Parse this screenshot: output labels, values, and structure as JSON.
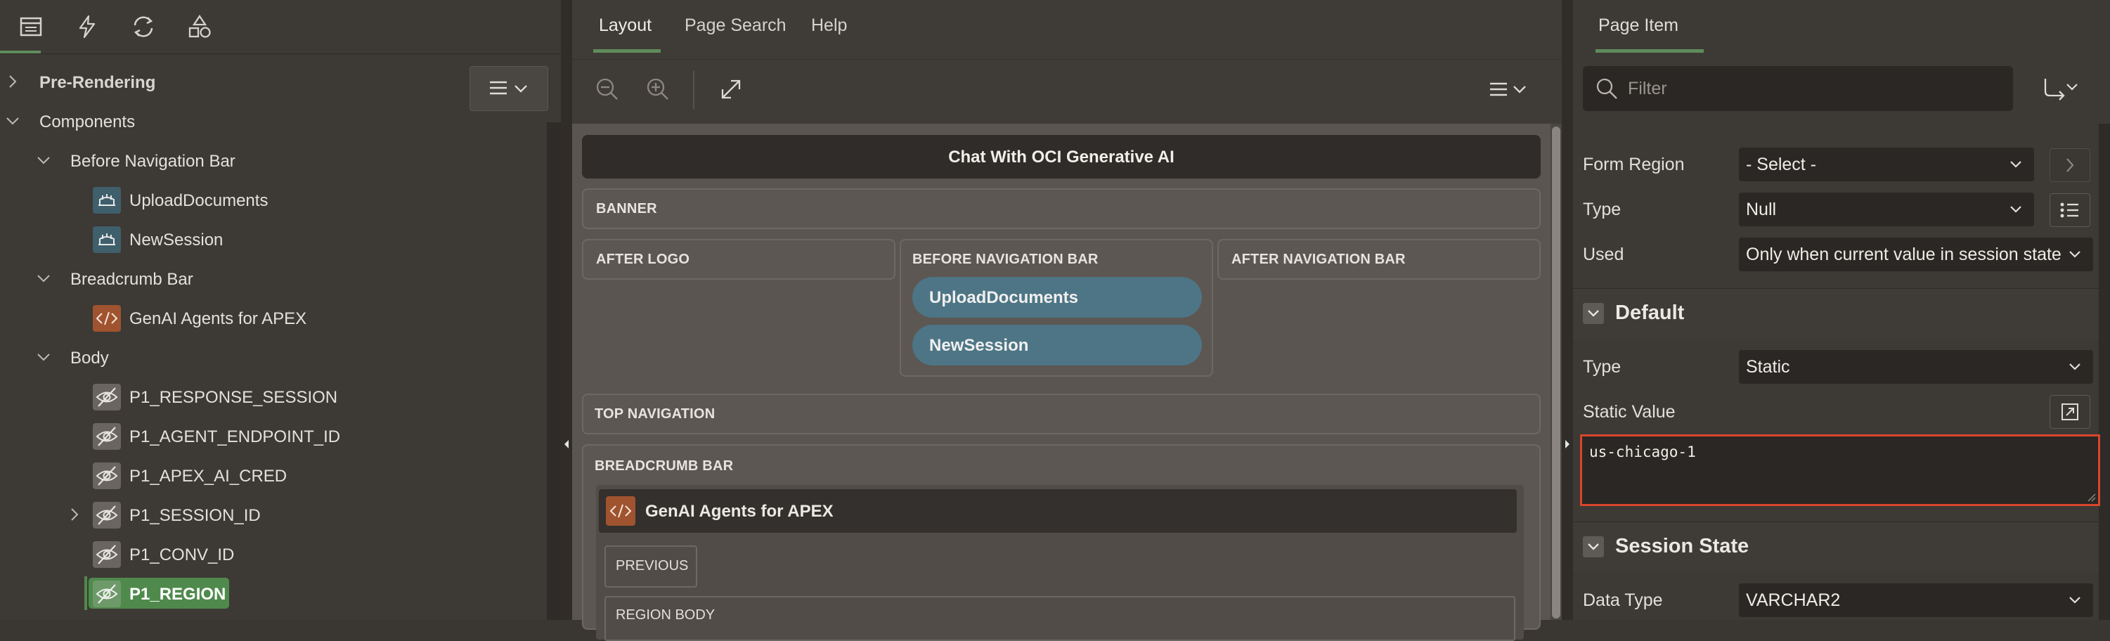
{
  "left_panel": {
    "tree": [
      {
        "label": "Pre-Rendering",
        "level": 0,
        "expanded": false,
        "icon": null,
        "selected": false
      },
      {
        "label": "Components",
        "level": 0,
        "expanded": true,
        "icon": null,
        "selected": false
      },
      {
        "label": "Before Navigation Bar",
        "level": 1,
        "expanded": true,
        "icon": null,
        "selected": false
      },
      {
        "label": "UploadDocuments",
        "level": 2,
        "icon": "button-icon",
        "selected": false
      },
      {
        "label": "NewSession",
        "level": 2,
        "icon": "button-icon",
        "selected": false
      },
      {
        "label": "Breadcrumb Bar",
        "level": 1,
        "expanded": true,
        "icon": null,
        "selected": false
      },
      {
        "label": "GenAI Agents for APEX",
        "level": 2,
        "icon": "code-icon",
        "selected": false
      },
      {
        "label": "Body",
        "level": 1,
        "expanded": true,
        "icon": null,
        "selected": false
      },
      {
        "label": "P1_RESPONSE_SESSION",
        "level": 2,
        "icon": "hidden-item-icon",
        "selected": false
      },
      {
        "label": "P1_AGENT_ENDPOINT_ID",
        "level": 2,
        "icon": "hidden-item-icon",
        "selected": false
      },
      {
        "label": "P1_APEX_AI_CRED",
        "level": 2,
        "icon": "hidden-item-icon",
        "selected": false
      },
      {
        "label": "P1_SESSION_ID",
        "level": 2,
        "icon": "hidden-item-icon",
        "expandable": true,
        "selected": false
      },
      {
        "label": "P1_CONV_ID",
        "level": 2,
        "icon": "hidden-item-icon",
        "selected": false
      },
      {
        "label": "P1_REGION",
        "level": 2,
        "icon": "hidden-item-icon",
        "selected": true
      }
    ]
  },
  "center_panel": {
    "tabs": [
      "Layout",
      "Page Search",
      "Help"
    ],
    "active_tab": "Layout",
    "page_title": "Chat With OCI Generative AI",
    "zones": {
      "banner": "BANNER",
      "after_logo": "AFTER LOGO",
      "before_nav": "BEFORE NAVIGATION BAR",
      "after_nav": "AFTER NAVIGATION BAR",
      "top_nav": "TOP NAVIGATION",
      "breadcrumb_bar": "BREADCRUMB BAR",
      "previous": "PREVIOUS",
      "region_body": "REGION BODY"
    },
    "buttons": [
      "UploadDocuments",
      "NewSession"
    ],
    "breadcrumb_region": "GenAI Agents for APEX"
  },
  "right_panel": {
    "tab": "Page Item",
    "filter_placeholder": "Filter",
    "form_region": {
      "label": "Form Region",
      "value": "- Select -"
    },
    "source_type": {
      "label": "Type",
      "value": "Null"
    },
    "used": {
      "label": "Used",
      "value": "Only when current value in session state"
    },
    "default_group": "Default",
    "default_type": {
      "label": "Type",
      "value": "Static"
    },
    "static_value": {
      "label": "Static Value",
      "value": "us-chicago-1"
    },
    "session_group": "Session State",
    "data_type": {
      "label": "Data Type",
      "value": "VARCHAR2"
    }
  },
  "colors": {
    "accent_green": "#5f8c5a",
    "selected_green": "#4f8a4c",
    "button_pill": "#4d7585",
    "highlight_red": "#d9452b"
  }
}
